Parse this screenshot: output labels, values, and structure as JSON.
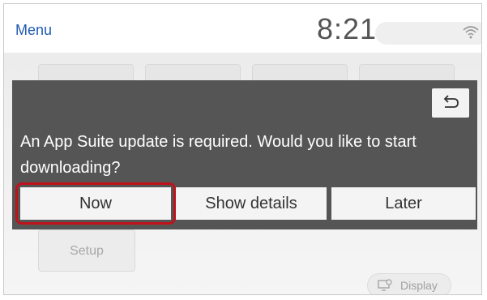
{
  "status_bar": {
    "menu_label": "Menu",
    "time": "8:21"
  },
  "home": {
    "setup_label": "Setup",
    "display_label": "Display"
  },
  "dialog": {
    "message": "An App Suite update is required. Would you like to start downloading?",
    "buttons": {
      "now": "Now",
      "show_details": "Show details",
      "later": "Later"
    }
  },
  "colors": {
    "menu_text": "#1e5ab4",
    "dialog_bg": "#555555",
    "highlight": "#c0121b"
  },
  "icons": [
    "wifi-icon",
    "back-arrow-icon",
    "display-icon"
  ]
}
